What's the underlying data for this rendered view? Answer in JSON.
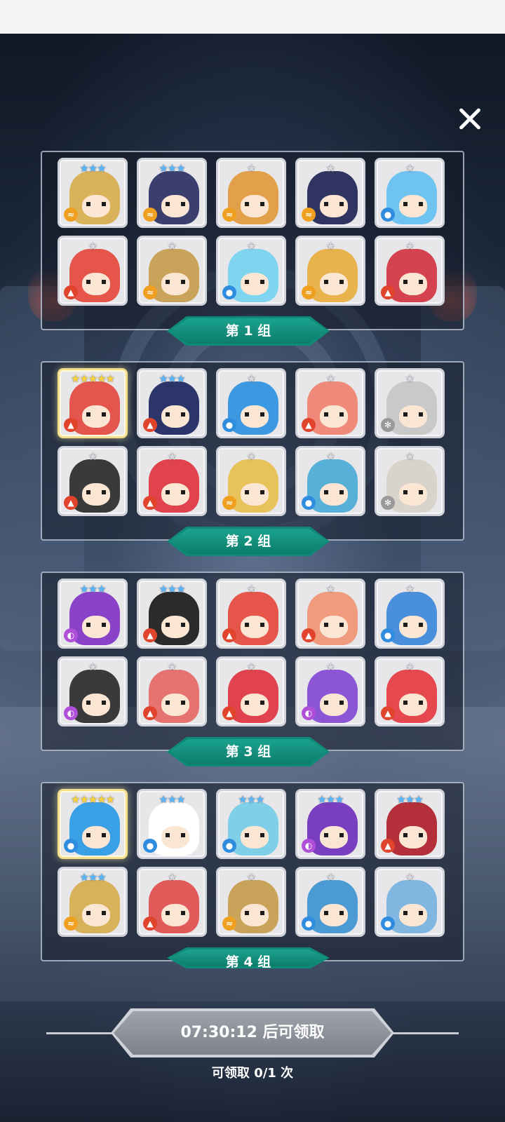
{
  "colors": {
    "ribbon": "#0f8a78",
    "panel_border": "#c8d2e1",
    "claim_button": "#8a8f97"
  },
  "close_icon": "close-icon",
  "groups": [
    {
      "label": "第 1 组",
      "heroes": [
        {
          "stars": "★★★",
          "star_color": "blue",
          "element": "wind",
          "color": "#d9b25a"
        },
        {
          "stars": "★★★",
          "star_color": "blue",
          "element": "wind",
          "color": "#3b3f6e"
        },
        {
          "stars": "★",
          "star_color": "white",
          "element": "wind",
          "color": "#e3a04a"
        },
        {
          "stars": "★",
          "star_color": "white",
          "element": "wind",
          "color": "#2f3560"
        },
        {
          "stars": "★",
          "star_color": "white",
          "element": "water",
          "color": "#6ec3f0"
        },
        {
          "stars": "★",
          "star_color": "white",
          "element": "fire",
          "color": "#e5554a"
        },
        {
          "stars": "★",
          "star_color": "white",
          "element": "wind",
          "color": "#caa35a"
        },
        {
          "stars": "★",
          "star_color": "white",
          "element": "water",
          "color": "#7fd4ef"
        },
        {
          "stars": "★",
          "star_color": "white",
          "element": "wind",
          "color": "#e8b34c"
        },
        {
          "stars": "★",
          "star_color": "white",
          "element": "fire",
          "color": "#d64350"
        }
      ]
    },
    {
      "label": "第 2 组",
      "heroes": [
        {
          "stars": "★★★★★",
          "star_color": "gold",
          "element": "fire",
          "color": "#e4554e",
          "gold": true
        },
        {
          "stars": "★★★",
          "star_color": "blue",
          "element": "fire",
          "color": "#2c3569"
        },
        {
          "stars": "★",
          "star_color": "white",
          "element": "water",
          "color": "#3c98e0"
        },
        {
          "stars": "★",
          "star_color": "white",
          "element": "fire",
          "color": "#ef8a7a"
        },
        {
          "stars": "★",
          "star_color": "white",
          "element": "light",
          "color": "#c9c9c9"
        },
        {
          "stars": "★",
          "star_color": "white",
          "element": "fire",
          "color": "#3a3a3a"
        },
        {
          "stars": "★",
          "star_color": "white",
          "element": "fire",
          "color": "#e0434d"
        },
        {
          "stars": "★",
          "star_color": "white",
          "element": "wind",
          "color": "#e8c25a"
        },
        {
          "stars": "★",
          "star_color": "white",
          "element": "water",
          "color": "#57b0d8"
        },
        {
          "stars": "★",
          "star_color": "white",
          "element": "light",
          "color": "#d8d4cc"
        }
      ]
    },
    {
      "label": "第 3 组",
      "heroes": [
        {
          "stars": "★★★",
          "star_color": "blue",
          "element": "arcane",
          "color": "#8a43c8"
        },
        {
          "stars": "★★★",
          "star_color": "blue",
          "element": "fire",
          "color": "#2b2b2b"
        },
        {
          "stars": "★",
          "star_color": "white",
          "element": "fire",
          "color": "#e5554a"
        },
        {
          "stars": "★",
          "star_color": "white",
          "element": "fire",
          "color": "#f09a7e"
        },
        {
          "stars": "★",
          "star_color": "white",
          "element": "water",
          "color": "#4a8fdc"
        },
        {
          "stars": "★",
          "star_color": "white",
          "element": "arcane",
          "color": "#3a3a3a"
        },
        {
          "stars": "★",
          "star_color": "white",
          "element": "fire",
          "color": "#e6736f"
        },
        {
          "stars": "★",
          "star_color": "white",
          "element": "fire",
          "color": "#e0434d"
        },
        {
          "stars": "★",
          "star_color": "white",
          "element": "arcane",
          "color": "#8b55d6"
        },
        {
          "stars": "★",
          "star_color": "white",
          "element": "fire",
          "color": "#e5484e"
        }
      ]
    },
    {
      "label": "第 4 组",
      "heroes": [
        {
          "stars": "★★★★★",
          "star_color": "gold",
          "element": "water",
          "color": "#3aa0e6",
          "gold": true
        },
        {
          "stars": "★★★",
          "star_color": "blue",
          "element": "water",
          "color": "#ffffff"
        },
        {
          "stars": "★★★",
          "star_color": "blue",
          "element": "water",
          "color": "#7fcfe8"
        },
        {
          "stars": "★★★",
          "star_color": "blue",
          "element": "arcane",
          "color": "#7a3fc0"
        },
        {
          "stars": "★★★",
          "star_color": "blue",
          "element": "fire",
          "color": "#b32f39"
        },
        {
          "stars": "★★★",
          "star_color": "blue",
          "element": "wind",
          "color": "#d8b25a"
        },
        {
          "stars": "★",
          "star_color": "white",
          "element": "fire",
          "color": "#e05a5a"
        },
        {
          "stars": "★",
          "star_color": "white",
          "element": "wind",
          "color": "#caa35a"
        },
        {
          "stars": "★",
          "star_color": "white",
          "element": "water",
          "color": "#4b9ad4"
        },
        {
          "stars": "★",
          "star_color": "white",
          "element": "water",
          "color": "#7fb7e0"
        }
      ]
    }
  ],
  "claim": {
    "button_label": "07:30:12 后可领取",
    "count_label": "可领取 0/1 次"
  }
}
